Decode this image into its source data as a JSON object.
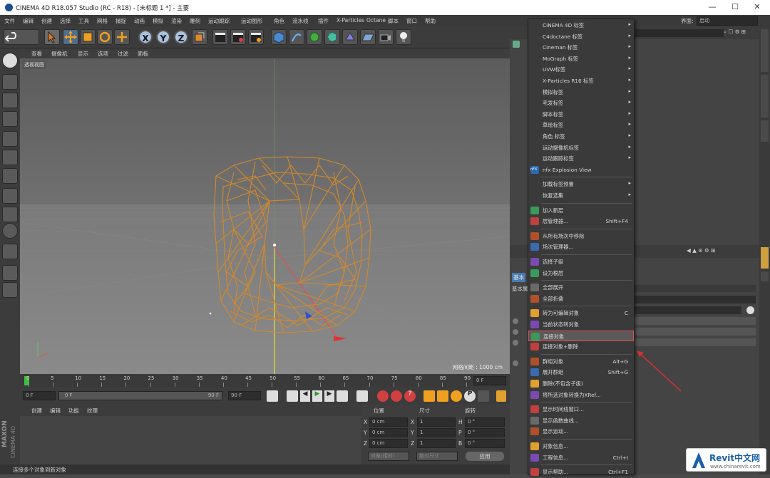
{
  "window": {
    "title": "CINEMA 4D R18.057 Studio (RC - R18) - [未标题 1 *] - 主要",
    "minimize": "—",
    "maximize": "☐",
    "close": "✕"
  },
  "menubar": [
    "文件",
    "编辑",
    "创建",
    "选择",
    "工具",
    "网格",
    "捕捉",
    "动画",
    "模拟",
    "渲染",
    "雕刻",
    "运动跟踪",
    "运动图形",
    "角色",
    "流水线",
    "插件",
    "X-Particles",
    "Octane",
    "脚本",
    "窗口",
    "帮助"
  ],
  "layout": {
    "label": "界面:",
    "value": "启动"
  },
  "toolbar": {
    "x": "X",
    "y": "Y",
    "z": "Z"
  },
  "viewport": {
    "menu": [
      "查看",
      "摄像机",
      "显示",
      "选项",
      "过滤",
      "面板"
    ],
    "label": "透视视图",
    "grid_info": "网格间距 : 1000 cm"
  },
  "timeline": {
    "ticks": [
      "0",
      "5",
      "10",
      "15",
      "20",
      "25",
      "30",
      "35",
      "40",
      "45",
      "50",
      "55",
      "60",
      "65",
      "70",
      "75",
      "80",
      "85",
      "90"
    ],
    "end": "0 F"
  },
  "playbar": {
    "start": "0 F",
    "cur": "0 F",
    "end_inner": "90 F",
    "end": "90 F"
  },
  "material": {
    "menu": [
      "创建",
      "编辑",
      "功能",
      "纹理"
    ]
  },
  "coords": {
    "headers": [
      "位置",
      "尺寸",
      "旋转"
    ],
    "rows": [
      {
        "a": "X",
        "pos": "0 cm",
        "b": "X",
        "size": "1",
        "c": "H",
        "rot": "0 °"
      },
      {
        "a": "Y",
        "pos": "0 cm",
        "b": "Y",
        "size": "1",
        "c": "P",
        "rot": "0 °"
      },
      {
        "a": "Z",
        "pos": "0 cm",
        "b": "Z",
        "size": "1",
        "c": "B",
        "rot": "0 °"
      }
    ],
    "mode1": "对象(相对)",
    "mode2": "绝对尺寸",
    "apply": "应用"
  },
  "status": "连接多个对象到新对象",
  "brand": {
    "maxon": "MAXON",
    "c4d": "CINEMA 4D"
  },
  "attr": {
    "tab1": "基本",
    "mode": "基本属性"
  },
  "right_strip": [
    "对象",
    "内容浏览器",
    "构造",
    "层"
  ],
  "context_menu": [
    {
      "label": "CINEMA 4D 标签",
      "arrow": true
    },
    {
      "label": "C4doctane 标签",
      "arrow": true
    },
    {
      "label": "Cineman 标签",
      "arrow": true
    },
    {
      "label": "MoGraph 标签",
      "arrow": true
    },
    {
      "label": "UVW标签",
      "arrow": true
    },
    {
      "label": "X-Particles R16 标签",
      "arrow": true
    },
    {
      "label": "模拟标签",
      "arrow": true
    },
    {
      "label": "毛发标签",
      "arrow": true
    },
    {
      "label": "脚本标签",
      "arrow": true
    },
    {
      "label": "草绘标签",
      "arrow": true
    },
    {
      "label": "角色 标签",
      "arrow": true
    },
    {
      "label": "运动摄像机标签",
      "arrow": true
    },
    {
      "label": "运动跟踪标签",
      "arrow": true
    },
    {
      "label": "nfx Explosion View",
      "icon": "nfx-icon"
    },
    {
      "sep": true
    },
    {
      "label": "加载标签预置",
      "arrow": true
    },
    {
      "label": "恢复选集",
      "arrow": true
    },
    {
      "sep": true
    },
    {
      "label": "加入新层",
      "icon": "layer-icon"
    },
    {
      "label": "层管理器...",
      "shortcut": "Shift+F4",
      "icon": "layer-manager-icon"
    },
    {
      "sep": true
    },
    {
      "label": "从所有场次中移除",
      "icon": "take-icon"
    },
    {
      "label": "场次管理器...",
      "icon": "take-manager-icon"
    },
    {
      "sep": true
    },
    {
      "label": "选择子级",
      "icon": "select-children-icon"
    },
    {
      "label": "设为根层",
      "icon": "root-icon"
    },
    {
      "sep": true
    },
    {
      "label": "全部展开",
      "icon": "expand-icon"
    },
    {
      "label": "全部折叠",
      "icon": "collapse-icon"
    },
    {
      "sep": true
    },
    {
      "label": "转为可编辑对象",
      "shortcut": "C",
      "icon": "editable-icon"
    },
    {
      "label": "当前状态转对象",
      "icon": "state-icon"
    },
    {
      "label": "连接对象",
      "icon": "connect-icon",
      "hl": true
    },
    {
      "label": "连接对象+删除",
      "icon": "connect-delete-icon"
    },
    {
      "sep": true
    },
    {
      "label": "群组对象",
      "shortcut": "Alt+G",
      "icon": "group-icon"
    },
    {
      "label": "展开群组",
      "shortcut": "Shift+G",
      "icon": "ungroup-icon"
    },
    {
      "label": "删除(不包含子级)",
      "icon": "delete-icon"
    },
    {
      "label": "将所选对象转换为XRef...",
      "icon": "xref-icon"
    },
    {
      "sep": true
    },
    {
      "label": "显示时间线窗口...",
      "icon": "timeline-icon"
    },
    {
      "label": "显示函数曲线...",
      "icon": "fcurve-icon"
    },
    {
      "label": "显示运动...",
      "icon": "motion-icon"
    },
    {
      "sep": true
    },
    {
      "label": "对象信息...",
      "icon": "info-icon"
    },
    {
      "label": "工程信息...",
      "shortcut": "Ctrl+I",
      "icon": "project-info-icon"
    },
    {
      "sep": true
    },
    {
      "label": "显示帮助...",
      "shortcut": "Ctrl+F1",
      "icon": "help-icon"
    }
  ],
  "watermark": {
    "brand": "Revit中文网",
    "url": "www.chinarevit.com"
  }
}
